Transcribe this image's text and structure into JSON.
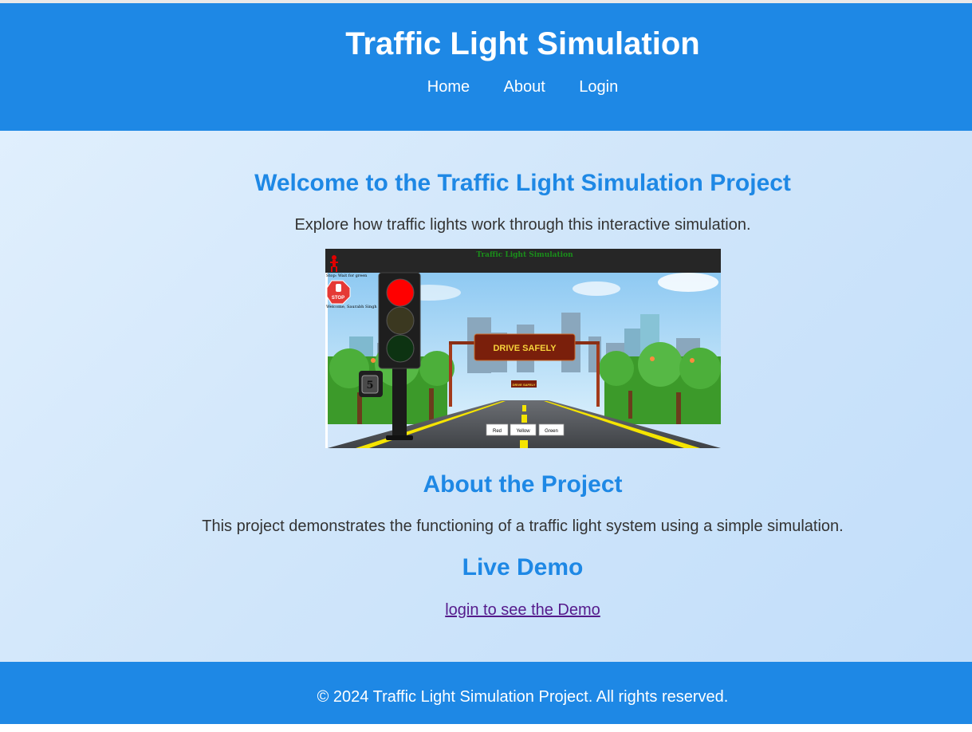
{
  "header": {
    "title": "Traffic Light Simulation",
    "nav": [
      "Home",
      "About",
      "Login"
    ]
  },
  "welcome": {
    "heading": "Welcome to the Traffic Light Simulation Project",
    "text": "Explore how traffic lights work through this interactive simulation."
  },
  "screenshot": {
    "title": "Traffic Light Simulation",
    "status": "Stop: Wait for green",
    "welcome": "Welcome, Saurabh Singh",
    "stop_sign": "STOP",
    "countdown": "5",
    "banner": "DRIVE SAFELY",
    "small_banner": "DRIVE SAFELY",
    "buttons": [
      "Red",
      "Yellow",
      "Green"
    ]
  },
  "about": {
    "heading": "About the Project",
    "text": "This project demonstrates the functioning of a traffic light system using a simple simulation."
  },
  "demo": {
    "heading": "Live Demo",
    "link": "login to see the Demo"
  },
  "footer": {
    "text": "© 2024 Traffic Light Simulation Project. All rights reserved."
  },
  "colors": {
    "primary": "#1e88e5",
    "link_visited": "#551a8b",
    "red_light": "#ff0000",
    "road_yellow": "#f5e400"
  }
}
